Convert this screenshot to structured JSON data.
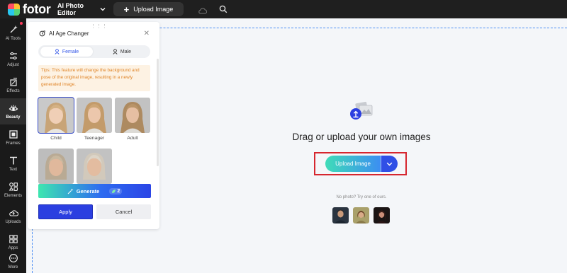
{
  "topbar": {
    "logo_text": "fotor",
    "editor_label": "AI Photo Editor",
    "upload_label": "Upload Image"
  },
  "rail": {
    "items": [
      {
        "label": "AI Tools",
        "icon": "ai-tools-icon"
      },
      {
        "label": "Adjust",
        "icon": "sliders-icon"
      },
      {
        "label": "Effects",
        "icon": "effects-icon"
      },
      {
        "label": "Beauty",
        "icon": "eye-icon"
      },
      {
        "label": "Frames",
        "icon": "frames-icon"
      },
      {
        "label": "Text",
        "icon": "text-icon"
      },
      {
        "label": "Elements",
        "icon": "elements-icon"
      },
      {
        "label": "Uploads",
        "icon": "upload-icon"
      },
      {
        "label": "Apps",
        "icon": "apps-icon"
      },
      {
        "label": "More",
        "icon": "more-icon"
      }
    ],
    "active": "Beauty"
  },
  "panel": {
    "title": "AI Age Changer",
    "tabs": {
      "female": "Female",
      "male": "Male"
    },
    "tips": "Tips: This feature will change the background and pose of the original image, resulting in a newly generated image.",
    "faces": [
      {
        "label": "Child",
        "selected": true
      },
      {
        "label": "Teenager",
        "selected": false
      },
      {
        "label": "Adult",
        "selected": false
      },
      {
        "label": "",
        "selected": false
      },
      {
        "label": "",
        "selected": false
      }
    ],
    "generate_label": "Generate",
    "generate_cost": "2",
    "apply_label": "Apply",
    "cancel_label": "Cancel"
  },
  "canvas": {
    "title": "Drag or upload your own images",
    "upload_button": "Upload Image",
    "no_photo": "No photo? Try one of ours."
  },
  "colors": {
    "accent": "#2b3fe0",
    "highlight": "#d6262f",
    "tips_text": "#e0862a"
  }
}
